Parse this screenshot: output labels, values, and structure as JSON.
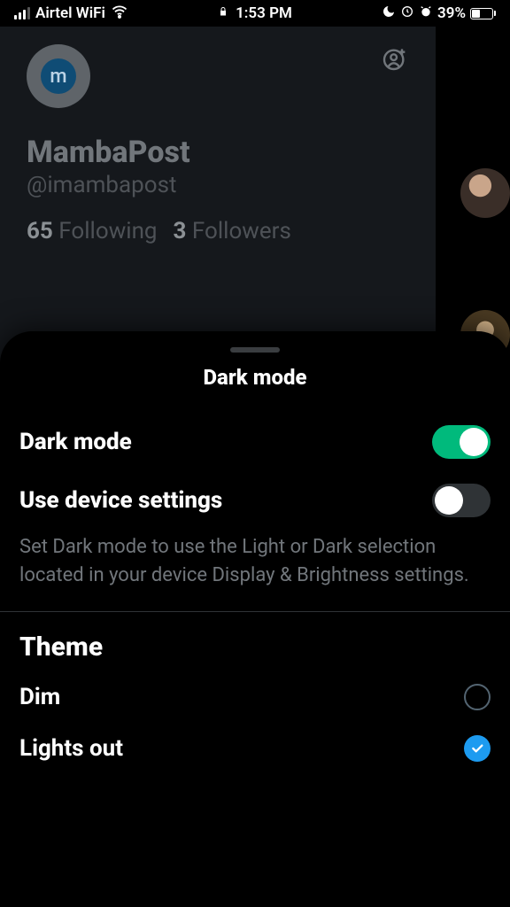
{
  "status": {
    "carrier": "Airtel WiFi",
    "time": "1:53 PM",
    "battery_pct": "39%"
  },
  "profile": {
    "avatar_letter": "m",
    "display_name": "MambaPost",
    "handle": "@imambapost",
    "following_count": "65",
    "following_label": "Following",
    "followers_count": "3",
    "followers_label": "Followers"
  },
  "sheet": {
    "title": "Dark mode",
    "dark_mode_label": "Dark mode",
    "dark_mode_on": true,
    "use_device_label": "Use device settings",
    "use_device_on": false,
    "use_device_desc": "Set Dark mode to use the Light or Dark selection located in your device Display & Brightness settings.",
    "theme_header": "Theme",
    "options": [
      {
        "label": "Dim",
        "selected": false
      },
      {
        "label": "Lights out",
        "selected": true
      }
    ]
  }
}
